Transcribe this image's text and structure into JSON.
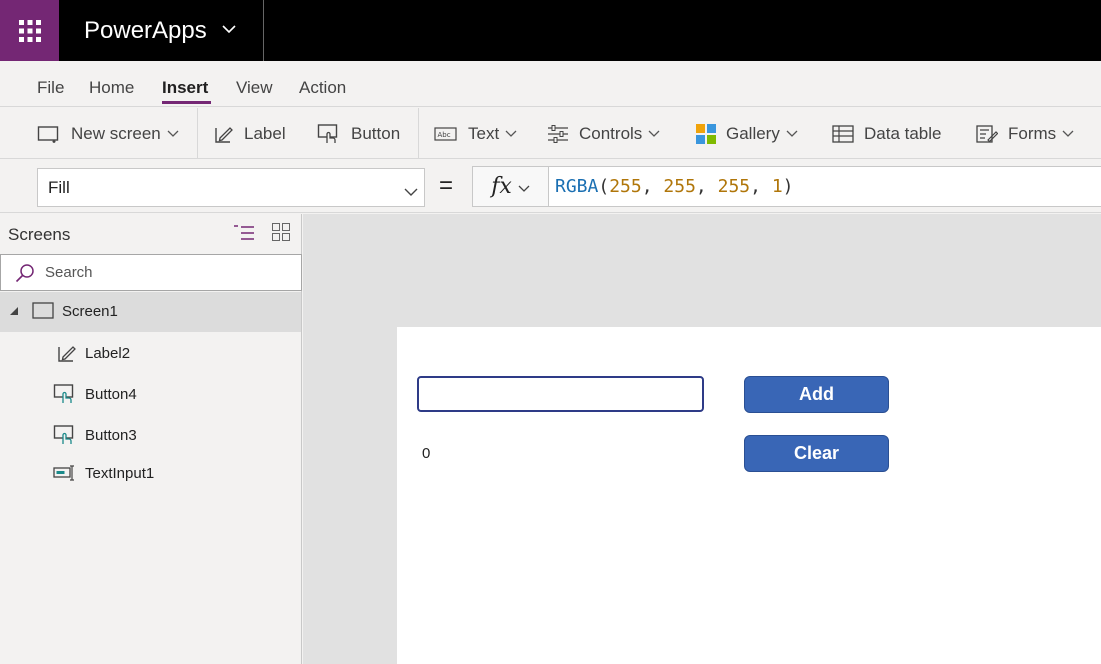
{
  "app": {
    "title": "PowerApps"
  },
  "menu": {
    "tabs": [
      {
        "label": "File"
      },
      {
        "label": "Home"
      },
      {
        "label": "Insert",
        "active": true
      },
      {
        "label": "View"
      },
      {
        "label": "Action"
      }
    ]
  },
  "ribbon": {
    "new_screen": "New screen",
    "label": "Label",
    "button": "Button",
    "text": "Text",
    "controls": "Controls",
    "gallery": "Gallery",
    "data_table": "Data table",
    "forms": "Forms"
  },
  "formula": {
    "property": "Fill",
    "equals": "=",
    "fx": "fx",
    "function": "RGBA",
    "args": [
      "255",
      "255",
      "255",
      "1"
    ]
  },
  "panel": {
    "title": "Screens",
    "search_placeholder": "Search",
    "tree": [
      {
        "label": "Screen1",
        "icon": "screen-icon"
      },
      {
        "label": "Label2",
        "icon": "label-edit-icon"
      },
      {
        "label": "Button4",
        "icon": "button-icon"
      },
      {
        "label": "Button3",
        "icon": "button-icon"
      },
      {
        "label": "TextInput1",
        "icon": "text-input-icon"
      }
    ]
  },
  "canvas": {
    "add_button": "Add",
    "clear_button": "Clear",
    "label_value": "0"
  },
  "colors": {
    "brand": "#742774",
    "button": "#3966b6",
    "input_border": "#2e3b87",
    "formula_function": "#1a6fb2",
    "formula_number": "#b0760a"
  }
}
